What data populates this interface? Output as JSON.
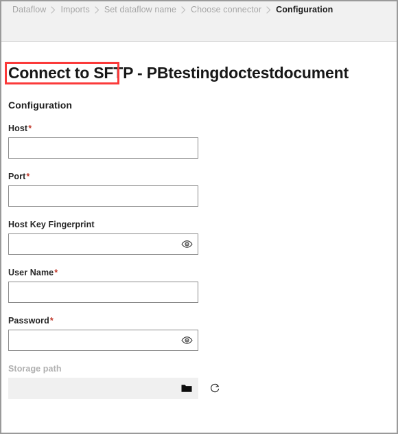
{
  "breadcrumb": {
    "items": [
      {
        "label": "Dataflow",
        "current": false
      },
      {
        "label": "Imports",
        "current": false
      },
      {
        "label": "Set dataflow name",
        "current": false
      },
      {
        "label": "Choose connector",
        "current": false
      },
      {
        "label": "Configuration",
        "current": true
      }
    ],
    "separator": "chevron-right-icon"
  },
  "page": {
    "title_highlighted": "Connect to SFTP",
    "title_rest": " - PBtestingdoctestdocument",
    "section_heading": "Configuration"
  },
  "annotation": {
    "color": "#fb3a3a",
    "target": "Connect to SFTP"
  },
  "form": {
    "fields": [
      {
        "name": "host",
        "label": "Host",
        "required": true,
        "value": "",
        "placeholder": "",
        "disabled": false,
        "trailing_icon": null,
        "side_icon": null
      },
      {
        "name": "port",
        "label": "Port",
        "required": true,
        "value": "",
        "placeholder": "",
        "disabled": false,
        "trailing_icon": null,
        "side_icon": null
      },
      {
        "name": "host-key-fingerprint",
        "label": "Host Key Fingerprint",
        "required": false,
        "value": "",
        "placeholder": "",
        "disabled": false,
        "trailing_icon": "eye-icon",
        "side_icon": null
      },
      {
        "name": "user-name",
        "label": "User Name",
        "required": true,
        "value": "",
        "placeholder": "",
        "disabled": false,
        "trailing_icon": null,
        "side_icon": null
      },
      {
        "name": "password",
        "label": "Password",
        "required": true,
        "value": "",
        "placeholder": "",
        "disabled": false,
        "trailing_icon": "eye-icon",
        "side_icon": null
      },
      {
        "name": "storage-path",
        "label": "Storage path",
        "required": false,
        "value": "",
        "placeholder": "",
        "disabled": true,
        "trailing_icon": "folder-icon",
        "side_icon": "refresh-icon"
      }
    ],
    "required_marker": "*"
  }
}
